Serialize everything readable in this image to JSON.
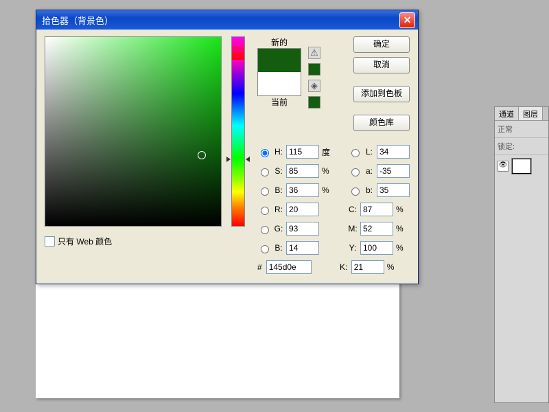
{
  "dialog": {
    "title": "拾色器（背景色）",
    "new_label": "新的",
    "current_label": "当前",
    "buttons": {
      "ok": "确定",
      "cancel": "取消",
      "add": "添加到色板",
      "library": "颜色库"
    },
    "web_only_label": "只有 Web 颜色",
    "hsb": {
      "h": {
        "label": "H:",
        "value": "115",
        "unit": "度"
      },
      "s": {
        "label": "S:",
        "value": "85",
        "unit": "%"
      },
      "b": {
        "label": "B:",
        "value": "36",
        "unit": "%"
      }
    },
    "lab": {
      "l": {
        "label": "L:",
        "value": "34"
      },
      "a": {
        "label": "a:",
        "value": "-35"
      },
      "b": {
        "label": "b:",
        "value": "35"
      }
    },
    "rgb": {
      "r": {
        "label": "R:",
        "value": "20"
      },
      "g": {
        "label": "G:",
        "value": "93"
      },
      "b": {
        "label": "B:",
        "value": "14"
      }
    },
    "cmyk": {
      "c": {
        "label": "C:",
        "value": "87",
        "unit": "%"
      },
      "m": {
        "label": "M:",
        "value": "52",
        "unit": "%"
      },
      "y": {
        "label": "Y:",
        "value": "100",
        "unit": "%"
      },
      "k": {
        "label": "K:",
        "value": "21",
        "unit": "%"
      }
    },
    "hex": {
      "prefix": "#",
      "value": "145d0e"
    }
  },
  "panel": {
    "tab1": "通道",
    "tab2": "图层",
    "mode": "正常",
    "lock": "锁定:"
  }
}
